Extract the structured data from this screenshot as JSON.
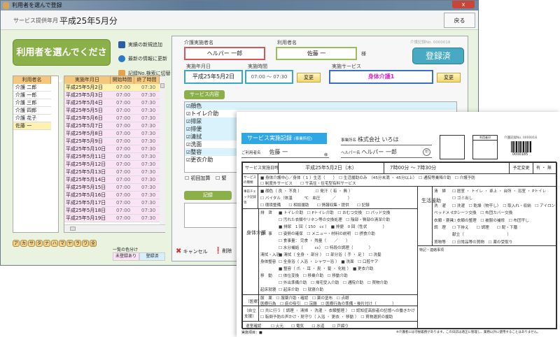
{
  "window": {
    "title": "利用者を選んで登録",
    "close": "x"
  },
  "header": {
    "label": "サービス提供年月",
    "value": "平成25年5月分",
    "back": "戻る"
  },
  "pick_user_button": "利用者を選んでください",
  "actions": [
    {
      "label": "実績の新規追加",
      "icon": "add-record-icon"
    },
    {
      "label": "最新の情報に更新",
      "icon": "refresh-icon"
    },
    {
      "label": "記録No.検索に切替",
      "icon": "switch-icon"
    }
  ],
  "users": {
    "header": "利用者名",
    "items": [
      "介護 二郎",
      "介護 一郎",
      "介護 三郎",
      "介護 四郎",
      "介護 花子",
      "佐藤 一"
    ],
    "selected": 5
  },
  "records": {
    "headers": [
      "実施年月日",
      "開始時間",
      "終了時間"
    ],
    "rows": [
      [
        "平成25年5月2日",
        "07:00",
        "07:30"
      ],
      [
        "平成25年5月3日",
        "07:00",
        "07:30"
      ],
      [
        "平成25年5月4日",
        "07:00",
        "07:30"
      ],
      [
        "平成25年5月5日",
        "07:00",
        "07:30"
      ],
      [
        "平成25年5月6日",
        "07:00",
        "07:30"
      ],
      [
        "平成25年5月7日",
        "07:00",
        "07:30"
      ],
      [
        "平成25年5月8日",
        "07:00",
        "07:30"
      ],
      [
        "平成25年5月9日",
        "07:00",
        "07:30"
      ],
      [
        "平成25年5月10日",
        "07:00",
        "07:30"
      ],
      [
        "平成25年5月11日",
        "07:00",
        "07:30"
      ],
      [
        "平成25年5月12日",
        "07:00",
        "07:30"
      ],
      [
        "平成25年5月13日",
        "07:00",
        "07:30"
      ],
      [
        "平成25年5月14日",
        "07:00",
        "07:30"
      ],
      [
        "平成25年5月15日",
        "07:00",
        "07:30"
      ],
      [
        "平成25年5月16日",
        "07:00",
        "07:30"
      ],
      [
        "平成25年5月17日",
        "07:00",
        "07:30"
      ],
      [
        "平成25年5月18日",
        "07:00",
        "07:30"
      ],
      [
        "平成25年5月19日",
        "07:00",
        "07:30"
      ]
    ],
    "selected": 0
  },
  "kana": [
    "ア",
    "カ",
    "サ",
    "タ",
    "ナ",
    "ハ",
    "マ",
    "ヤ",
    "ラ",
    "ワ",
    "全"
  ],
  "legend": {
    "title": "一覧の色分け",
    "unregistered": "未登録あり",
    "registered": "登録済",
    "unregistered_color": "#fbe3f6",
    "registered_color": "#d6f0fb"
  },
  "form": {
    "caregiver_label": "介護実施者名",
    "caregiver": "ヘルパー 一郎",
    "user_label": "利用者名",
    "user": "佐藤 一",
    "honorific": "様",
    "record_no": "介護記録No. 0000018",
    "registered_button": "登録済",
    "date_label": "実施年月日",
    "date": "平成25年5月2日",
    "time_label": "実施時間",
    "time": "07:00 ～ 07:30",
    "change": "変更",
    "service_label": "実施サービス",
    "service": "身体介護1",
    "content_tab": "サービス内容",
    "content_items": [
      "顔色",
      "トイレ介助",
      "排尿",
      "排便",
      "清拭",
      "洗面",
      "整容",
      "更衣介助"
    ],
    "first_addition": "初回加算",
    "urgent": "緊",
    "record_tab": "記録",
    "cancel": "キャンセル",
    "delete": "削除"
  },
  "doc": {
    "title": "サービス実施記録",
    "title_sub": "(事業所控)",
    "office_label": "事業所名",
    "office": "株式会社 いろは",
    "user_label": "ご利用者名",
    "user": "佐藤 一",
    "honorific": "様",
    "helper_label": "ヘルパー名",
    "helper": "ヘルパー 一郎",
    "seal": "印",
    "user_seal_label": "利用者印",
    "record_no": "介護記録No. 0000018",
    "barcode_text": "0000185",
    "datetime_label": "サービス実施日時",
    "date": "平成25年5月2日（木）",
    "time": "7時00分 ～ 7時30分",
    "plan_change_label": "予定変更",
    "plan_change": "有 ・ 無",
    "service_type_label": "サービスの種類",
    "service_type_lines": [
      "■ 身体介護中心／身体（ 1 ）生活（　　）　☐ 生活援助のみ　（45分未満 ・ 45分以上）　☐ 通院等乗降介助　☐ 介護予防",
      "☐ 制度外サービス　　☐ サ高住・住宅型有料サービス"
    ],
    "precheck_label": "事前チェック記録等",
    "precheck_lines": [
      "■ 顔色（ 良 ・ 不良 ）　　　　☐ 発汗（ 有 ・ 無 ）",
      "☐ バイタル（体温　　　℃　血圧　　　／　　　）",
      "☐ 環境整備　　☐ 相談援助　　☐ 情報収集・提供　　☐ 記録"
    ],
    "body_label": "身体介護",
    "body_lines": [
      {
        "label": "排　泄",
        "text": "■ トイレ介助　☐ Pトイレ介助　☐ おむつ交換　☐ パッド交換"
      },
      {
        "label": "",
        "text": "☐ 汚れた衣類やリネン等の交換処理　☐ 陰部・臀部の清潔介助"
      },
      {
        "label": "",
        "text": "■ 排尿　1 回（ 150　cc ）　■ 排便　0 回（性状　　　　）"
      },
      {
        "label": "食　事",
        "text": "☐ 姿勢の確保　☐ メニュー・材料の説明　☐ 摂食介助"
      },
      {
        "label": "",
        "text": "☐ 食事量： 完食 ・ 残量（　　／　　）"
      },
      {
        "label": "",
        "text": "☐ 水分補給（　　　cc）　☐ 特段の調理（　　　　）"
      },
      {
        "label": "清拭・入浴",
        "text": "■ 清拭（ 全身 ・ 部分 ）　☐ 部分浴（ 手 ・ 足 ）　☐ 洗髪"
      },
      {
        "label": "身体整容",
        "text": "☐ 全身浴（ 入浴 ・ シャワー浴 ）　■ 洗面　☐ 口腔ケア"
      },
      {
        "label": "",
        "text": "■ 整容（ 爪 ・ 耳 ・ 髭 ・ 髪 ・ 化粧 ）　■ 更衣介助"
      },
      {
        "label": "移　動",
        "text": "☐ 体位変換　☐ 移乗介助　☐ 移動介助"
      },
      {
        "label": "",
        "text": "☐ 外出準備介助　☐ 帰宅受入介助　☐ 通院介助　☐ 買物介助"
      },
      {
        "label": "起床就寝",
        "text": "☐ 起床介助　☐ 就寝介助"
      }
    ],
    "life_label": "生活援助",
    "life_lines": [
      {
        "label": "清　掃",
        "text": "☐ 居室 ・ トイレ ・ 卓上 ・ 台所 ・ 浴室 ・ Pトイレ"
      },
      {
        "label": "",
        "text": "☐ ゴミ出し"
      },
      {
        "label": "洗　濯",
        "text": "☐ 洗濯　☐ 乾燥（物干し）　☐ 取入れ・収納　☐ アイロン"
      },
      {
        "label": "ベッドメイク",
        "text": "☐ シーツ交換　☐ 布団カバー交換"
      },
      {
        "label": "衣類・寝具",
        "text": "☐ 衣類の整理　☐ 被服の補修　☐ 布団干し"
      },
      {
        "label": "調　理",
        "text": "☐ 下拵え　　☐ 調理　　☐ 配・下膳"
      },
      {
        "label": "",
        "text": "献立（　　　　　　　　　　　）"
      },
      {
        "label": "買物等",
        "text": "☐ 日常品等の買物　☐ 薬の受取り"
      }
    ],
    "notes_label": "特記・連絡事項",
    "medical_label": "（医療）",
    "medical_lines": [
      {
        "label": "服　薬",
        "text": "☐ 服薬介助・確認　☐ 薬の塗布　☐ 点眼"
      },
      {
        "label": "医療行為",
        "text": "☐ 痰の吸引　☐ 浣腸　☐ 医療行為の準備・後片付け（　　　　）"
      }
    ],
    "independence_label": "（自立支援）",
    "independence_lines": [
      "☐ 共に行う（ 調理 ・ 清掃 ・ 洗濯 ・ 衣類整理 ）　☐ 認知症高齢者の記憶への働きかけ",
      "☐ 転倒予防の声かけ・見守り（ 入浴 ・ 更衣 ・ 移動 ）　☐ 買物選択の援助"
    ],
    "exit_label": "退室確認",
    "exit_text": "☐ 火元　　☐ 電気　　☐ 水道　　☐ 戸締り",
    "footer_left": "実施項目：■",
    "footer_right": "※介護者には守秘義務があります。この日誌は適正に管理し、業務以外に使用することはありません。"
  }
}
